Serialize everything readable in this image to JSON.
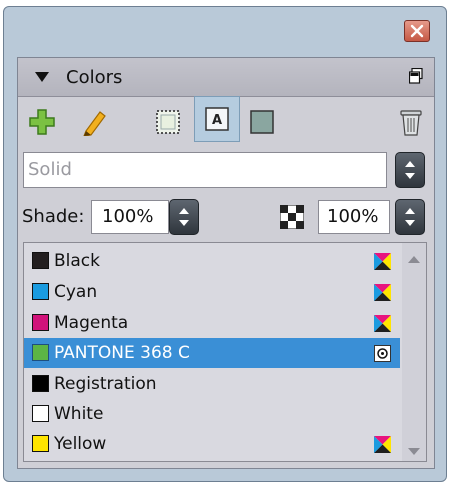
{
  "panel": {
    "title": "Colors"
  },
  "tint": {
    "value": "Solid"
  },
  "shade": {
    "label": "Shade:",
    "value": "100%"
  },
  "opacity": {
    "value": "100%"
  },
  "swatches": [
    {
      "name": "Black",
      "color": "#231f20",
      "cmyk": true
    },
    {
      "name": "Cyan",
      "color": "#1a9be0",
      "cmyk": true
    },
    {
      "name": "Magenta",
      "color": "#d1127a",
      "cmyk": true
    },
    {
      "name": "PANTONE 368 C",
      "color": "#5cb546",
      "spot": true,
      "selected": true
    },
    {
      "name": "Registration",
      "color": "#000000"
    },
    {
      "name": "White",
      "color": "#ffffff"
    },
    {
      "name": "Yellow",
      "color": "#ffe500",
      "cmyk": true
    }
  ],
  "colors": {
    "selection": "#3a8fd6",
    "panel": "#cfcfd6",
    "window": "#b9c9d8"
  },
  "icons": [
    "close-icon",
    "collapse-triangle-icon",
    "panel-menu-icon",
    "new-swatch-icon",
    "edit-pencil-icon",
    "fill-icon",
    "text-icon",
    "stroke-icon",
    "trash-icon",
    "cmyk-icon",
    "spot-icon",
    "scroll-up-icon",
    "scroll-down-icon"
  ]
}
